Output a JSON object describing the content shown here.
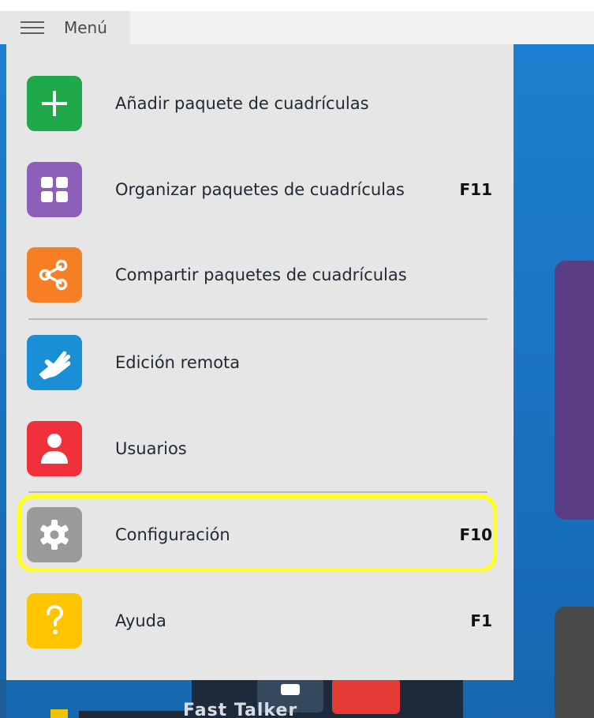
{
  "header": {
    "title": "Menú"
  },
  "colors": {
    "highlight": "#ffff1a",
    "add": "#1fa94b",
    "organize": "#8e5fb8",
    "share": "#f57f22",
    "remote": "#1b8fd6",
    "users": "#f0303a",
    "settings": "#9a9a9a",
    "help": "#ffc400"
  },
  "menu": {
    "items": [
      {
        "label": "Añadir paquete de cuadrículas",
        "shortcut": "",
        "icon": "plus-icon"
      },
      {
        "label": "Organizar paquetes de cuadrículas",
        "shortcut": "F11",
        "icon": "grid-icon"
      },
      {
        "label": "Compartir paquetes de cuadrículas",
        "shortcut": "",
        "icon": "share-icon"
      },
      {
        "label": "Edición remota",
        "shortcut": "",
        "icon": "hand-icon"
      },
      {
        "label": "Usuarios",
        "shortcut": "",
        "icon": "user-icon"
      },
      {
        "label": "Configuración",
        "shortcut": "F10",
        "icon": "gear-icon",
        "highlighted": true
      },
      {
        "label": "Ayuda",
        "shortcut": "F1",
        "icon": "question-icon"
      }
    ]
  },
  "background": {
    "bottom_text": "Fast Talker"
  }
}
